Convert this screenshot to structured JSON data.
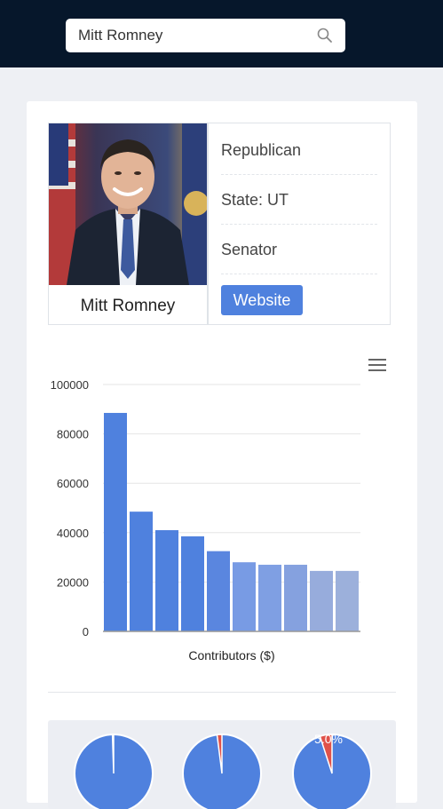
{
  "search": {
    "value": "Mitt Romney"
  },
  "profile": {
    "name": "Mitt Romney",
    "party": "Republican",
    "state": "State: UT",
    "office": "Senator",
    "website_label": "Website"
  },
  "chart_data": [
    {
      "type": "bar",
      "xlabel": "Contributors ($)",
      "ylim": [
        0,
        100000
      ],
      "yticks": [
        "0",
        "20000",
        "40000",
        "60000",
        "80000",
        "100000"
      ],
      "values": [
        88500,
        48500,
        41000,
        38500,
        32500,
        28000,
        27000,
        27000,
        24500,
        24500
      ],
      "colors": [
        "#4f81de",
        "#4f81de",
        "#4f81de",
        "#4f81de",
        "#5a86df",
        "#789be4",
        "#7f9fe3",
        "#85a1df",
        "#97acdc",
        "#9cb0db"
      ],
      "grid": true
    },
    {
      "type": "pie",
      "pies": [
        {
          "slice_fraction": 0.005,
          "label": ""
        },
        {
          "slice_fraction": 0.02,
          "label": ""
        },
        {
          "slice_fraction": 0.05,
          "label": "5.0%"
        }
      ],
      "colors": {
        "main": "#4f81de",
        "slice": "#e0524a"
      }
    }
  ]
}
